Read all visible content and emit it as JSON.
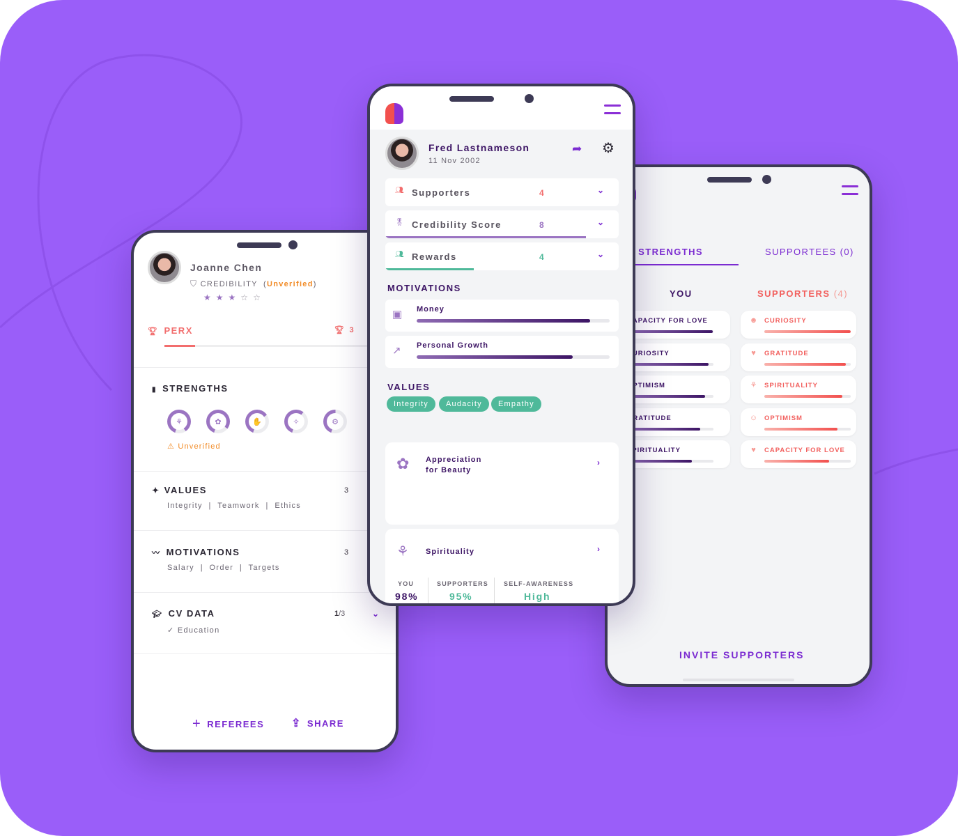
{
  "left_phone": {
    "profile": {
      "name": "Joanne Chen",
      "credibility_label": "CREDIBILITY",
      "credibility_status": "Unverified",
      "rating": 3,
      "rating_max": 5,
      "stars": [
        "★",
        "★",
        "★",
        "☆",
        "☆"
      ]
    },
    "perx": {
      "label": "PERX",
      "count": "3",
      "progress": 0.13
    },
    "strengths": {
      "title": "STRENGTHS",
      "rings": [
        {
          "icon": "meditation-icon",
          "glyph": "⚘",
          "fraction": 0.85
        },
        {
          "icon": "flower-icon",
          "glyph": "✿",
          "fraction": 0.8
        },
        {
          "icon": "hand-icon",
          "glyph": "✋",
          "fraction": 0.6
        },
        {
          "icon": "party-popper-icon",
          "glyph": "✧",
          "fraction": 0.55
        },
        {
          "icon": "head-gear-icon",
          "glyph": "⚙",
          "fraction": 0.45
        }
      ],
      "status": "Unverified"
    },
    "values": {
      "title": "VALUES",
      "count": "3",
      "items": "Integrity  |  Teamwork  |  Ethics"
    },
    "motivations": {
      "title": "MOTIVATIONS",
      "count": "3",
      "items": "Salary  |  Order  |  Targets"
    },
    "cv_data": {
      "title": "CV DATA",
      "count_done": "1",
      "count_total": "/3",
      "item": "Education"
    },
    "actions": {
      "referees": "REFEREES",
      "share": "SHARE"
    }
  },
  "middle_phone": {
    "profile": {
      "name": "Fred Lastnameson",
      "dob": "11 Nov 2002"
    },
    "stats": [
      {
        "label": "Supporters",
        "value": "4",
        "color": "#f26d6d",
        "progress": null
      },
      {
        "label": "Credibility Score",
        "value": "8",
        "color": "#9b74c2",
        "progress": 0.86
      },
      {
        "label": "Rewards",
        "value": "4",
        "color": "#4fb99a",
        "progress": 0.38
      }
    ],
    "motivations": {
      "title": "MOTIVATIONS",
      "items": [
        {
          "label": "Money",
          "progress": 0.9
        },
        {
          "label": "Personal Growth",
          "progress": 0.81
        }
      ]
    },
    "values": {
      "title": "VALUES",
      "chips": [
        "Integrity",
        "Audacity",
        "Empathy"
      ]
    },
    "strength_cards": [
      {
        "title_line1": "Appreciation",
        "title_line2": "for Beauty"
      },
      {
        "title_line1": "Spirituality",
        "title_line2": ""
      }
    ],
    "spirituality_stats": {
      "you_label": "YOU",
      "you_value": "98%",
      "supporters_label": "SUPPORTERS",
      "supporters_value": "95%",
      "self_awareness_label": "SELF-AWARENESS",
      "self_awareness_value": "High"
    }
  },
  "right_phone": {
    "tabs": [
      {
        "label": "YOUR STRENGTHS",
        "active": true
      },
      {
        "label": "SUPPORTEES (0)",
        "active": false
      }
    ],
    "you_header": "YOU",
    "supporters_header": "SUPPORTERS",
    "supporters_count": "(4)",
    "you_strengths": [
      {
        "label": "CAPACITY FOR LOVE",
        "progress": 0.99
      },
      {
        "label": "CURIOSITY",
        "progress": 0.94
      },
      {
        "label": "OPTIMISM",
        "progress": 0.9
      },
      {
        "label": "GRATITUDE",
        "progress": 0.85
      },
      {
        "label": "SPIRITUALITY",
        "progress": 0.75
      }
    ],
    "supporter_strengths": [
      {
        "label": "CURIOSITY",
        "icon": "head-flower-icon",
        "glyph": "☻",
        "progress": 1.0
      },
      {
        "label": "GRATITUDE",
        "icon": "hand-heart-icon",
        "glyph": "♥",
        "progress": 0.94
      },
      {
        "label": "SPIRITUALITY",
        "icon": "meditation-icon",
        "glyph": "⚘",
        "progress": 0.9
      },
      {
        "label": "OPTIMISM",
        "icon": "smile-icon",
        "glyph": "☺",
        "progress": 0.85
      },
      {
        "label": "CAPACITY FOR LOVE",
        "icon": "heart-icon",
        "glyph": "♥",
        "progress": 0.75
      }
    ],
    "invite_label": "INVITE SUPPORTERS"
  }
}
